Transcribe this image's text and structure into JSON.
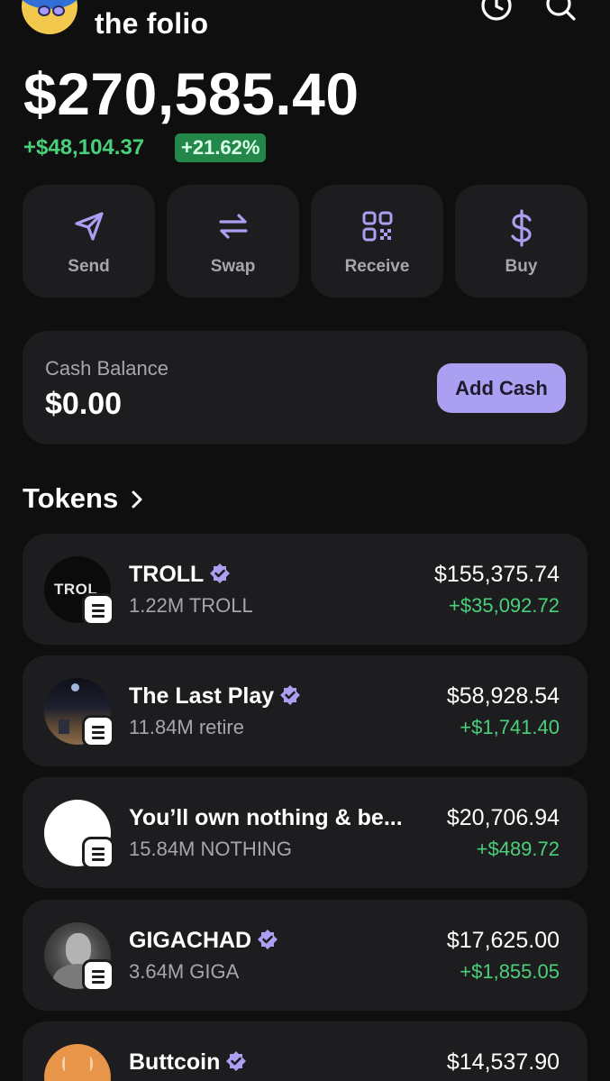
{
  "header": {
    "wallet_name": "the folio",
    "history_icon": "clock-icon",
    "search_icon": "search-icon"
  },
  "portfolio": {
    "balance": "$270,585.40",
    "change_amount": "+$48,104.37",
    "change_percent": "+21.62%"
  },
  "actions": [
    {
      "label": "Send",
      "icon": "send-icon"
    },
    {
      "label": "Swap",
      "icon": "swap-icon"
    },
    {
      "label": "Receive",
      "icon": "qr-code-icon"
    },
    {
      "label": "Buy",
      "icon": "dollar-icon"
    }
  ],
  "cash": {
    "label": "Cash Balance",
    "value": "$0.00",
    "button": "Add Cash"
  },
  "tokens": {
    "title": "Tokens",
    "items": [
      {
        "name": "TROLL",
        "verified": true,
        "amount": "1.22M TROLL",
        "value": "$155,375.74",
        "change": "+$35,092.72",
        "logo_text": "TROL"
      },
      {
        "name": "The Last Play",
        "verified": true,
        "amount": "11.84M retire",
        "value": "$58,928.54",
        "change": "+$1,741.40"
      },
      {
        "name": "You’ll own nothing & be...",
        "verified": false,
        "amount": "15.84M NOTHING",
        "value": "$20,706.94",
        "change": "+$489.72"
      },
      {
        "name": "GIGACHAD",
        "verified": true,
        "amount": "3.64M GIGA",
        "value": "$17,625.00",
        "change": "+$1,855.05"
      },
      {
        "name": "Buttcoin",
        "verified": true,
        "amount": "",
        "value": "$14,537.90",
        "change": ""
      }
    ]
  },
  "colors": {
    "background": "#0f0f10",
    "card": "#1d1d1f",
    "accent": "#ab9ff2",
    "positive": "#4ad07a"
  }
}
